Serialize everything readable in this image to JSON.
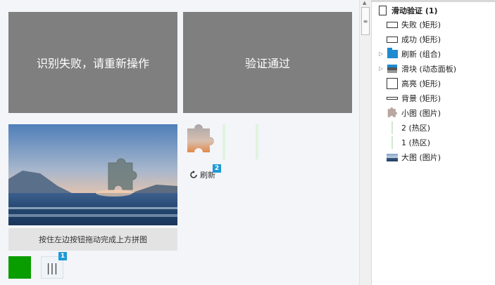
{
  "canvas": {
    "fail_panel_text": "识别失败，请重新操作",
    "success_panel_text": "验证通过",
    "hint_text": "按住左边按钮拖动完成上方拼图",
    "refresh_label": "刷新",
    "refresh_badge": "2",
    "slider_handle": "|||",
    "slider_badge": "1",
    "colors": {
      "panel": "#7f7f7f",
      "success_block": "#0a9d00",
      "badge": "#1f9ad6"
    }
  },
  "outline": {
    "items": [
      {
        "label": "滑动验证 (1)",
        "icon": "page-icon"
      },
      {
        "label": "失败 (矩形)",
        "icon": "rectangle-icon"
      },
      {
        "label": "成功 (矩形)",
        "icon": "rectangle-icon"
      },
      {
        "label": "刷新 (组合)",
        "icon": "folder-icon"
      },
      {
        "label": "滑块 (动态面板)",
        "icon": "dynamic-panel-icon"
      },
      {
        "label": "高亮 (矩形)",
        "icon": "rectangle-icon"
      },
      {
        "label": "背景 (矩形)",
        "icon": "rectangle-icon"
      },
      {
        "label": "小图 (图片)",
        "icon": "puzzle-image-icon"
      },
      {
        "label": "2 (热区)",
        "icon": "hotspot-icon"
      },
      {
        "label": "1 (热区)",
        "icon": "hotspot-icon"
      },
      {
        "label": "大图 (图片)",
        "icon": "image-icon"
      }
    ]
  }
}
